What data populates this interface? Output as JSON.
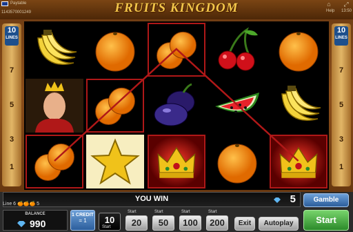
{
  "window": {
    "title": "FRUITS KINGDOM",
    "paytable_label": "Paytable",
    "session_code": "1143570001249",
    "help_label": "Help",
    "clock": "13:50"
  },
  "lines_panel": {
    "count": "10",
    "label": "LINES",
    "numbers": [
      "7",
      "5",
      "3",
      "1"
    ]
  },
  "reels": [
    [
      "banana",
      "king",
      "orange"
    ],
    [
      "orange",
      "orange",
      "star"
    ],
    [
      "orange",
      "plum",
      "crown"
    ],
    [
      "cherry",
      "watermelon",
      "orange"
    ],
    [
      "orange",
      "banana",
      "crown"
    ]
  ],
  "highlighted": [
    [
      2,
      0
    ],
    [
      1,
      1
    ],
    [
      0,
      2
    ],
    [
      2,
      2
    ],
    [
      4,
      2
    ]
  ],
  "status": {
    "you_win_label": "YOU WIN",
    "win_amount": "5",
    "line_info": "Line 6 🍊🍊🍊 5"
  },
  "balance": {
    "label": "BALANCE",
    "value": "990"
  },
  "credit": {
    "label": "1 CREDIT",
    "value": "= 1"
  },
  "bets": [
    {
      "label": "10",
      "sub": "Start",
      "selected": true
    },
    {
      "label": "20",
      "sub": "Start",
      "selected": false
    },
    {
      "label": "50",
      "sub": "Start",
      "selected": false
    },
    {
      "label": "100",
      "sub": "Start",
      "selected": false
    },
    {
      "label": "200",
      "sub": "Start",
      "selected": false
    }
  ],
  "buttons": {
    "gamble": "Gamble",
    "start": "Start",
    "autoplay": "Autoplay",
    "exit": "Exit"
  },
  "colors": {
    "frame": "#8b4e1a",
    "title_gold": "#f3c64a",
    "win_line": "#b01818",
    "lines_blue": "#1d4f8c",
    "start_green": "#2b8a2a"
  }
}
